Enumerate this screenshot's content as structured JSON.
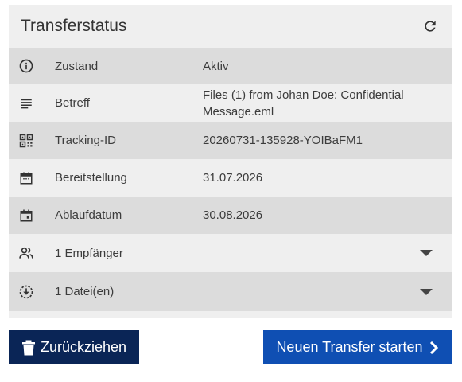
{
  "panel": {
    "title": "Transferstatus",
    "refresh_icon": "refresh-icon"
  },
  "rows": [
    {
      "key": "status",
      "icon": "info-icon",
      "label": "Zustand",
      "value": "Aktiv"
    },
    {
      "key": "subject",
      "icon": "lines-icon",
      "label": "Betreff",
      "value": "Files (1) from Johan Doe: Confidential Message.eml"
    },
    {
      "key": "tracking",
      "icon": "qr-code-icon",
      "label": "Tracking-ID",
      "value": "20260731-135928-YOIBaFM1"
    },
    {
      "key": "provided",
      "icon": "calendar-icon",
      "label": "Bereitstellung",
      "value": "31.07.2026"
    },
    {
      "key": "expiry",
      "icon": "calendar-event-icon",
      "label": "Ablaufdatum",
      "value": "30.08.2026"
    },
    {
      "key": "recipients",
      "icon": "people-icon",
      "label": "1 Empfänger",
      "value": ""
    },
    {
      "key": "files",
      "icon": "download-circle-icon",
      "label": "1 Datei(en)",
      "value": ""
    }
  ],
  "actions": {
    "withdraw_label": "Zurückziehen",
    "new_transfer_label": "Neuen Transfer starten"
  },
  "colors": {
    "withdraw_bg": "#0a2556",
    "new_transfer_bg": "#0f4fb3",
    "row_dark": "#dcdcdc",
    "row_light": "#efefef"
  }
}
